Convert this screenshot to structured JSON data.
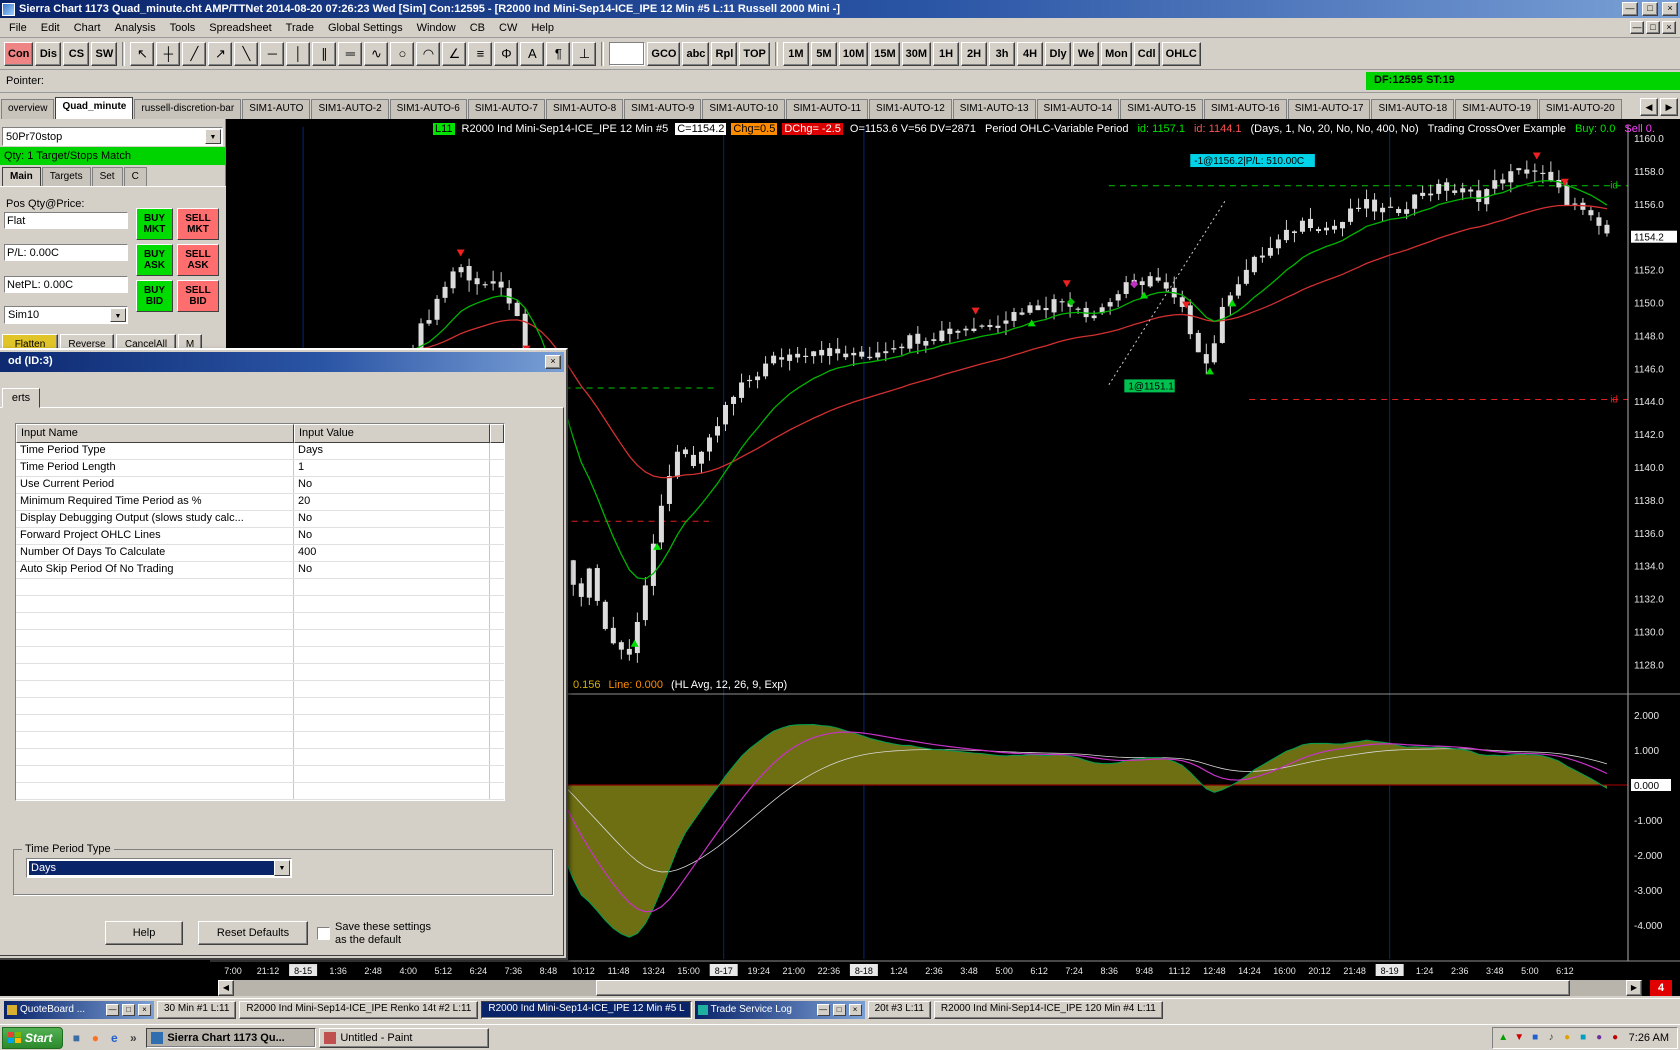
{
  "window": {
    "title": "Sierra Chart 1173 Quad_minute.cht  AMP/TTNet 2014-08-20  07:26:23 Wed [Sim]  Con:12595 - [R2000 Ind Mini-Sep14-ICE_IPE  12 Min  #5  L:11  Russell 2000 Mini -]",
    "controls": [
      "—",
      "□",
      "×"
    ]
  },
  "menus": [
    "File",
    "Edit",
    "Chart",
    "Analysis",
    "Tools",
    "Spreadsheet",
    "Trade",
    "Global Settings",
    "Window",
    "CB",
    "CW",
    "Help"
  ],
  "toolbar": {
    "left_buttons": [
      {
        "label": "Con",
        "accent": true
      },
      {
        "label": "Dis",
        "accent": false
      },
      {
        "label": "CS",
        "accent": false
      },
      {
        "label": "SW",
        "accent": false
      }
    ],
    "tools": [
      {
        "name": "pointer-tool",
        "glyph": "↖"
      },
      {
        "name": "crosshair-tool",
        "glyph": "┼"
      },
      {
        "name": "trendline-tool",
        "glyph": "╱"
      },
      {
        "name": "ray-tool",
        "glyph": "↗"
      },
      {
        "name": "extending-line-tool",
        "glyph": "╲"
      },
      {
        "name": "horizontal-line-tool",
        "glyph": "─"
      },
      {
        "name": "vertical-line-tool",
        "glyph": "│"
      },
      {
        "name": "parallel-lines-tool",
        "glyph": "∥"
      },
      {
        "name": "price-projection-tool",
        "glyph": "═"
      },
      {
        "name": "zigzag-tool",
        "glyph": "∿"
      },
      {
        "name": "ellipse-tool",
        "glyph": "○"
      },
      {
        "name": "arc-tool",
        "glyph": "◠"
      },
      {
        "name": "angle-tool",
        "glyph": "∠"
      },
      {
        "name": "fib-retracement-tool",
        "glyph": "≡"
      },
      {
        "name": "fib-fan-tool",
        "glyph": "Φ"
      },
      {
        "name": "text-tool",
        "glyph": "A"
      },
      {
        "name": "marker-tool",
        "glyph": "¶"
      },
      {
        "name": "anchor-tool",
        "glyph": "⊥"
      }
    ],
    "mid_buttons": [
      "GCO",
      "abc",
      "Rpl",
      "TOP"
    ],
    "timeframes": [
      "1M",
      "5M",
      "10M",
      "15M",
      "30M",
      "1H",
      "2H",
      "3h",
      "4H",
      "Dly",
      "We",
      "Mon",
      "Cdl",
      "OHLC"
    ]
  },
  "pointer_bar": {
    "label": "Pointer:",
    "status": "DF:12595  ST:19"
  },
  "chart_tabs": {
    "items": [
      "overview",
      "Quad_minute",
      "russell-discretion-bar",
      "SIM1-AUTO",
      "SIM1-AUTO-2",
      "SIM1-AUTO-6",
      "SIM1-AUTO-7",
      "SIM1-AUTO-8",
      "SIM1-AUTO-9",
      "SIM1-AUTO-10",
      "SIM1-AUTO-11",
      "SIM1-AUTO-12",
      "SIM1-AUTO-13",
      "SIM1-AUTO-14",
      "SIM1-AUTO-15",
      "SIM1-AUTO-16",
      "SIM1-AUTO-17",
      "SIM1-AUTO-18",
      "SIM1-AUTO-19",
      "SIM1-AUTO-20"
    ],
    "active_index": 1,
    "scroll_left": "◀",
    "scroll_right": "▶"
  },
  "trade_panel": {
    "template": "50Pr70stop",
    "qty_status": "Qty: 1 Target/Stops Match",
    "tabs": [
      "Main",
      "Targets",
      "Set",
      "C"
    ],
    "pos_label": "Pos Qty@Price:",
    "pos_value": "Flat",
    "pl_value": "P/L: 0.00C",
    "netpl_value": "NetPL: 0.00C",
    "account": "Sim10",
    "order_buttons": [
      {
        "name": "buy-mkt",
        "lines": [
          "BUY",
          "MKT"
        ],
        "side": "buy"
      },
      {
        "name": "sell-mkt",
        "lines": [
          "SELL",
          "MKT"
        ],
        "side": "sell"
      },
      {
        "name": "buy-ask",
        "lines": [
          "BUY",
          "ASK"
        ],
        "side": "buy"
      },
      {
        "name": "sell-ask",
        "lines": [
          "SELL",
          "ASK"
        ],
        "side": "sell"
      },
      {
        "name": "buy-bid",
        "lines": [
          "BUY",
          "BID"
        ],
        "side": "buy"
      },
      {
        "name": "sell-bid",
        "lines": [
          "SELL",
          "BID"
        ],
        "side": "sell"
      }
    ],
    "bottom_buttons": [
      {
        "name": "flatten",
        "label": "Flatten",
        "bg": "#e0c428"
      },
      {
        "name": "reverse",
        "label": "Reverse",
        "bg": "#d4d0c8"
      },
      {
        "name": "cancel-all",
        "label": "CancelAll",
        "bg": "#d4d0c8"
      },
      {
        "name": "more",
        "label": "M",
        "bg": "#d4d0c8"
      }
    ]
  },
  "dialog": {
    "title": "od (ID:3)",
    "tab": "erts",
    "col1": "Input Name",
    "col2": "Input Value",
    "rows": [
      [
        "Time Period Type",
        "Days"
      ],
      [
        "Time Period Length",
        "1"
      ],
      [
        "Use Current Period",
        "No"
      ],
      [
        "Minimum Required Time Period as %",
        "20"
      ],
      [
        "Display Debugging Output (slows study calc...",
        "No"
      ],
      [
        "Forward Project OHLC Lines",
        "No"
      ],
      [
        "Number Of Days To Calculate",
        "400"
      ],
      [
        "Auto Skip Period Of No Trading",
        "No"
      ]
    ],
    "empty_rows": 13,
    "group_label": "Time Period Type",
    "combo_value": "Days",
    "help": "Help",
    "reset": "Reset Defaults",
    "save_line1": "Save these settings",
    "save_line2": "as the default"
  },
  "chart": {
    "info_segments": [
      {
        "text": "L11",
        "fg": "#000000",
        "bg": "#00e400"
      },
      {
        "text": "R2000 Ind Mini-Sep14-ICE_IPE  12 Min  #5",
        "fg": "#ffffff",
        "bg": ""
      },
      {
        "text": "C=1154.2",
        "fg": "#000000",
        "bg": "#ffffff"
      },
      {
        "text": "Chg=0.5",
        "fg": "#000000",
        "bg": "#ff8c00"
      },
      {
        "text": "DChg= -2.5",
        "fg": "#ffffff",
        "bg": "#dd0000"
      },
      {
        "text": "O=1153.6 V=56 DV=2871",
        "fg": "#ffffff",
        "bg": ""
      },
      {
        "text": "Period OHLC-Variable Period",
        "fg": "#ffffff",
        "bg": ""
      },
      {
        "text": "id: 1157.1",
        "fg": "#00e400",
        "bg": ""
      },
      {
        "text": "id: 1144.1",
        "fg": "#ff5050",
        "bg": ""
      },
      {
        "text": "(Days, 1, No, 20, No, No, 400, No)",
        "fg": "#ffffff",
        "bg": ""
      },
      {
        "text": "Trading CrossOver Example",
        "fg": "#ffffff",
        "bg": ""
      },
      {
        "text": "Buy: 0.0",
        "fg": "#00e400",
        "bg": ""
      },
      {
        "text": "Sell 0.",
        "fg": "#ff40ff",
        "bg": ""
      }
    ],
    "macd_info": [
      {
        "text": "0.156",
        "fg": "#d8b000"
      },
      {
        "text": "Line: 0.000",
        "fg": "#ff8c00"
      },
      {
        "text": "(HL Avg, 12, 26, 9, Exp)",
        "fg": "#ffffff"
      }
    ],
    "price_labels": [
      "1160.0",
      "1158.0",
      "1156.0",
      "1154.2",
      "1152.0",
      "1150.0",
      "1148.0",
      "1146.0",
      "1144.0",
      "1142.0",
      "1140.0",
      "1138.0",
      "1136.0",
      "1134.0",
      "1132.0",
      "1130.0",
      "1128.0"
    ],
    "price_current": "1154.2",
    "macd_labels": [
      "2.000",
      "1.000",
      "0.000",
      "-1.000",
      "-2.000",
      "-3.000",
      "-4.000"
    ],
    "macd_current": "0.000",
    "time_labels": [
      "7:00",
      "21:12",
      "8-15",
      "1:36",
      "2:48",
      "4:00",
      "5:12",
      "6:24",
      "7:36",
      "8:48",
      "10:12",
      "11:48",
      "13:24",
      "15:00",
      "8-17",
      "19:24",
      "21:00",
      "22:36",
      "8-18",
      "1:24",
      "2:36",
      "3:48",
      "5:00",
      "6:12",
      "7:24",
      "8:36",
      "9:48",
      "11:12",
      "12:48",
      "14:24",
      "16:00",
      "20:12",
      "21:48",
      "8-19",
      "1:24",
      "2:36",
      "3:48",
      "5:00",
      "6:12"
    ],
    "date_label_indices": [
      2,
      14,
      18,
      33
    ],
    "alert_count": "4",
    "scroll_left": "◀",
    "scroll_right": "▶"
  },
  "chart_data": {
    "type": "candlestick",
    "symbol": "R2000 Ind Mini-Sep14-ICE_IPE",
    "interval": "12 Min",
    "price_axis": {
      "min": 1128.0,
      "max": 1160.0,
      "step": 2.0
    },
    "macd_axis": {
      "min": -4.0,
      "max": 2.0,
      "step": 1.0
    },
    "bars": 150,
    "last_close": 1154.2,
    "price_path": [
      [
        0.134,
        1147.5
      ],
      [
        0.15,
        1150.0
      ],
      [
        0.165,
        1152.3
      ],
      [
        0.178,
        1151.3
      ],
      [
        0.195,
        1150.8
      ],
      [
        0.205,
        1150.0
      ],
      [
        0.213,
        1147.0
      ],
      [
        0.222,
        1143.5
      ],
      [
        0.232,
        1139.0
      ],
      [
        0.242,
        1134.5
      ],
      [
        0.252,
        1131.5
      ],
      [
        0.26,
        1133.8
      ],
      [
        0.268,
        1131.0
      ],
      [
        0.278,
        1129.2
      ],
      [
        0.287,
        1128.6
      ],
      [
        0.295,
        1131.2
      ],
      [
        0.305,
        1134.8
      ],
      [
        0.315,
        1139.2
      ],
      [
        0.325,
        1141.6
      ],
      [
        0.335,
        1139.8
      ],
      [
        0.345,
        1141.4
      ],
      [
        0.357,
        1143.6
      ],
      [
        0.372,
        1145.2
      ],
      [
        0.392,
        1146.6
      ],
      [
        0.42,
        1147.2
      ],
      [
        0.45,
        1146.6
      ],
      [
        0.48,
        1147.6
      ],
      [
        0.51,
        1148.2
      ],
      [
        0.54,
        1148.6
      ],
      [
        0.57,
        1149.6
      ],
      [
        0.6,
        1150.2
      ],
      [
        0.618,
        1149.2
      ],
      [
        0.64,
        1150.8
      ],
      [
        0.66,
        1151.6
      ],
      [
        0.68,
        1149.8
      ],
      [
        0.7,
        1146.2
      ],
      [
        0.715,
        1150.6
      ],
      [
        0.73,
        1152.2
      ],
      [
        0.75,
        1153.6
      ],
      [
        0.77,
        1155.0
      ],
      [
        0.79,
        1154.4
      ],
      [
        0.81,
        1156.0
      ],
      [
        0.83,
        1155.4
      ],
      [
        0.852,
        1156.6
      ],
      [
        0.872,
        1157.0
      ],
      [
        0.892,
        1156.4
      ],
      [
        0.912,
        1157.6
      ],
      [
        0.932,
        1158.2
      ],
      [
        0.952,
        1156.6
      ],
      [
        0.97,
        1155.2
      ],
      [
        0.985,
        1154.2
      ]
    ],
    "buy_arrows": [
      0.292,
      0.308,
      0.575,
      0.655,
      0.702,
      0.718
    ],
    "sell_arrows": [
      0.168,
      0.215,
      0.535,
      0.6,
      0.685,
      0.935,
      0.955
    ],
    "diamonds": [
      {
        "f": 0.603,
        "color": "#00c000"
      },
      {
        "f": 0.648,
        "color": "#c030c0"
      }
    ],
    "position_labels": [
      {
        "text": "-1@1156.2|P/L: 510.00C",
        "f": 0.688,
        "price": 1158.6,
        "bg": "#00d2e8"
      },
      {
        "text": "1@1151.1",
        "f": 0.641,
        "price": 1144.9,
        "bg": "#00c050"
      }
    ],
    "trade_line": {
      "f1": 0.63,
      "p1": 1145.0,
      "f2": 0.713,
      "p2": 1156.2
    },
    "id_lines": [
      {
        "price": 1157.1,
        "color": "#00c800",
        "f1": 0.63,
        "f2": 1.0,
        "label": "id"
      },
      {
        "price": 1144.1,
        "color": "#e02020",
        "f1": 0.73,
        "f2": 1.0,
        "label": "id"
      },
      {
        "price": 1144.8,
        "color": "#00c800",
        "f1": 0.195,
        "f2": 0.35,
        "label": ""
      },
      {
        "price": 1136.7,
        "color": "#e02020",
        "f1": 0.2,
        "f2": 0.345,
        "label": ""
      }
    ]
  },
  "bottom_windows": {
    "quoteboard": {
      "title": "QuoteBoard ...",
      "controls": [
        "—",
        "□",
        "×"
      ]
    },
    "chips": [
      {
        "label": "30 Min  #1  L:11",
        "active": false
      },
      {
        "label": "R2000 Ind Mini-Sep14-ICE_IPE  Renko 14t  #2  L:11",
        "active": false
      },
      {
        "label": "R2000 Ind Mini-Sep14-ICE_IPE  12 Min  #5  L",
        "active": true
      }
    ],
    "trade_log": {
      "title": "Trade Service Log",
      "controls": [
        "—",
        "□",
        "×"
      ]
    },
    "chips2": [
      {
        "label": "20t  #3  L:11",
        "active": false
      },
      {
        "label": "R2000 Ind Mini-Sep14-ICE_IPE  120 Min  #4  L:11",
        "active": false
      }
    ]
  },
  "taskbar": {
    "start_label": "Start",
    "quick_launch": [
      {
        "name": "quick-launch-desktop-icon",
        "glyph": "■",
        "color": "#3a6ea5"
      },
      {
        "name": "quick-launch-firefox-icon",
        "glyph": "●",
        "color": "#ff7020"
      },
      {
        "name": "quick-launch-ie-icon",
        "glyph": "e",
        "color": "#2060d0"
      },
      {
        "name": "quick-launch-overflow-chevron",
        "glyph": "»",
        "color": "#404040"
      }
    ],
    "tasks": [
      {
        "label": "Sierra Chart 1173 Qu...",
        "active": true,
        "icon": "#2f6fb0"
      },
      {
        "label": "Untitled - Paint",
        "active": false,
        "icon": "#c05050"
      }
    ],
    "tray_icons": [
      {
        "name": "tray-connection-up-icon",
        "glyph": "▲",
        "color": "#00a000"
      },
      {
        "name": "tray-connection-down-icon",
        "glyph": "▼",
        "color": "#d00000"
      },
      {
        "name": "tray-chart-icon",
        "glyph": "■",
        "color": "#2060d0"
      },
      {
        "name": "tray-volume-icon",
        "glyph": "♪",
        "color": "#404040"
      },
      {
        "name": "tray-shield-icon",
        "glyph": "●",
        "color": "#e0a000"
      },
      {
        "name": "tray-network-icon",
        "glyph": "■",
        "color": "#00a0c0"
      },
      {
        "name": "tray-update-icon",
        "glyph": "●",
        "color": "#7030a0"
      },
      {
        "name": "tray-antivirus-icon",
        "glyph": "●",
        "color": "#c00000"
      }
    ],
    "clock": "7:26 AM"
  }
}
